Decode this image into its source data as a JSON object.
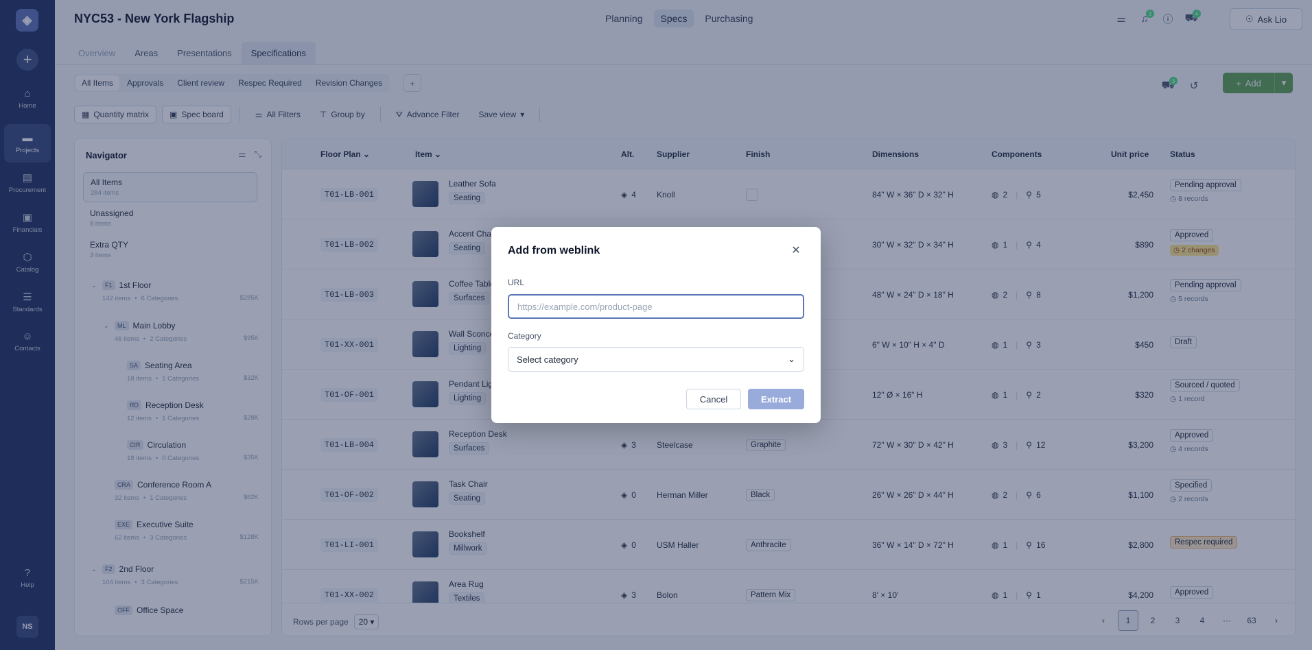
{
  "rail": {
    "items": [
      {
        "label": "Home",
        "icon": "home-icon"
      },
      {
        "label": "Projects",
        "icon": "folder-icon"
      },
      {
        "label": "Procurement",
        "icon": "clipboard-icon"
      },
      {
        "label": "Financials",
        "icon": "wallet-icon"
      },
      {
        "label": "Catalog",
        "icon": "box-icon"
      },
      {
        "label": "Standards",
        "icon": "list-icon"
      },
      {
        "label": "Contacts",
        "icon": "contacts-icon"
      }
    ],
    "help": "Help",
    "avatar": "NS"
  },
  "header": {
    "title": "NYC53 - New York Flagship",
    "modules": [
      "Planning",
      "Specs",
      "Purchasing"
    ],
    "badges": {
      "notifications": "3",
      "cart": "4"
    },
    "ask": "Ask Lio"
  },
  "tabs": [
    "Overview",
    "Areas",
    "Presentations",
    "Specifications"
  ],
  "views": [
    "All Items",
    "Approvals",
    "Client review",
    "Respec Required",
    "Revision Changes"
  ],
  "actions": {
    "badge": "3",
    "add": "Add"
  },
  "toolbar": [
    "Quantity matrix",
    "Spec board",
    "All Filters",
    "Group by",
    "Advance Filter",
    "Save view"
  ],
  "navigator": {
    "title": "Navigator",
    "top": [
      {
        "label": "All Items",
        "sub": "284 items"
      },
      {
        "label": "Unassigned",
        "sub": "8 items"
      },
      {
        "label": "Extra QTY",
        "sub": "3 items"
      }
    ],
    "tree": [
      {
        "code": "F1",
        "label": "1st Floor",
        "items": "142 items",
        "cats": "6 Categories",
        "amt": "$285K"
      },
      {
        "code": "ML",
        "label": "Main Lobby",
        "items": "46 items",
        "cats": "2 Categories",
        "amt": "$95K"
      },
      {
        "code": "SA",
        "label": "Seating Area",
        "items": "18 items",
        "cats": "1 Categories",
        "amt": "$32K"
      },
      {
        "code": "RD",
        "label": "Reception Desk",
        "items": "12 items",
        "cats": "1 Categories",
        "amt": "$28K"
      },
      {
        "code": "CIR",
        "label": "Circulation",
        "items": "18 items",
        "cats": "0 Categories",
        "amt": "$35K"
      },
      {
        "code": "CRA",
        "label": "Conference Room A",
        "items": "32 items",
        "cats": "1 Categories",
        "amt": "$62K"
      },
      {
        "code": "EXE",
        "label": "Executive Suite",
        "items": "62 items",
        "cats": "3 Categories",
        "amt": "$128K"
      },
      {
        "code": "F2",
        "label": "2nd Floor",
        "items": "104 items",
        "cats": "3 Categories",
        "amt": "$215K"
      },
      {
        "code": "OFF",
        "label": "Office Space",
        "items": "",
        "cats": "",
        "amt": ""
      }
    ]
  },
  "table": {
    "headers": [
      "Floor Plan",
      "Item",
      "Alt.",
      "Supplier",
      "Finish",
      "Dimensions",
      "Components",
      "Unit price",
      "Status"
    ],
    "rows": [
      {
        "fp": "T01-LB-001",
        "name": "Leather Sofa",
        "cat": "Seating",
        "alt": "4",
        "supplier": "Knoll",
        "finish": "",
        "dim": "84\" W × 36\" D × 32\" H",
        "c1": "2",
        "c2": "5",
        "price": "$2,450",
        "status": "Pending approval",
        "sub": "8 records",
        "subtype": "rec"
      },
      {
        "fp": "T01-LB-002",
        "name": "Accent Chair",
        "cat": "Seating",
        "alt": "",
        "supplier": "",
        "finish": "",
        "dim": "30\" W × 32\" D × 34\" H",
        "c1": "1",
        "c2": "4",
        "price": "$890",
        "status": "Approved",
        "sub": "2 changes",
        "subtype": "warn"
      },
      {
        "fp": "T01-LB-003",
        "name": "Coffee Table",
        "cat": "Surfaces",
        "alt": "",
        "supplier": "",
        "finish": "",
        "dim": "48\" W × 24\" D × 18\" H",
        "c1": "2",
        "c2": "8",
        "price": "$1,200",
        "status": "Pending approval",
        "sub": "5 records",
        "subtype": "rec"
      },
      {
        "fp": "T01-XX-001",
        "name": "Wall Sconce",
        "cat": "Lighting",
        "alt": "",
        "supplier": "",
        "finish": "",
        "dim": "6\" W × 10\" H × 4\" D",
        "c1": "1",
        "c2": "3",
        "price": "$450",
        "status": "Draft",
        "sub": "",
        "subtype": ""
      },
      {
        "fp": "T01-OF-001",
        "name": "Pendant Light",
        "cat": "Lighting",
        "alt": "",
        "supplier": "",
        "finish": "",
        "dim": "12\" Ø × 16\" H",
        "c1": "1",
        "c2": "2",
        "price": "$320",
        "status": "Sourced / quoted",
        "sub": "1 record",
        "subtype": "rec"
      },
      {
        "fp": "T01-LB-004",
        "name": "Reception Desk",
        "cat": "Surfaces",
        "alt": "3",
        "supplier": "Steelcase",
        "finish": "Graphite",
        "dim": "72\" W × 30\" D × 42\" H",
        "c1": "3",
        "c2": "12",
        "price": "$3,200",
        "status": "Approved",
        "sub": "4 records",
        "subtype": "rec"
      },
      {
        "fp": "T01-OF-002",
        "name": "Task Chair",
        "cat": "Seating",
        "alt": "0",
        "supplier": "Herman Miller",
        "finish": "Black",
        "dim": "26\" W × 26\" D × 44\" H",
        "c1": "2",
        "c2": "6",
        "price": "$1,100",
        "status": "Specified",
        "sub": "2 records",
        "subtype": "rec"
      },
      {
        "fp": "T01-LI-001",
        "name": "Bookshelf",
        "cat": "Millwork",
        "alt": "0",
        "supplier": "USM Haller",
        "finish": "Anthracite",
        "dim": "36\" W × 14\" D × 72\" H",
        "c1": "1",
        "c2": "16",
        "price": "$2,800",
        "status": "Respec required",
        "sub": "",
        "subtype": ""
      },
      {
        "fp": "T01-XX-002",
        "name": "Area Rug",
        "cat": "Textiles",
        "alt": "3",
        "supplier": "Bolon",
        "finish": "Pattern Mix",
        "dim": "8' × 10'",
        "c1": "1",
        "c2": "1",
        "price": "$4,200",
        "status": "Approved",
        "sub": "",
        "subtype": ""
      }
    ],
    "rows_per_page_label": "Rows per page",
    "rows_per_page": "20",
    "pages": [
      "1",
      "2",
      "3",
      "4",
      "···",
      "63"
    ]
  },
  "modal": {
    "title": "Add from weblink",
    "url_label": "URL",
    "url_placeholder": "https://example.com/product-page",
    "category_label": "Category",
    "category_value": "Select category",
    "cancel": "Cancel",
    "extract": "Extract"
  }
}
